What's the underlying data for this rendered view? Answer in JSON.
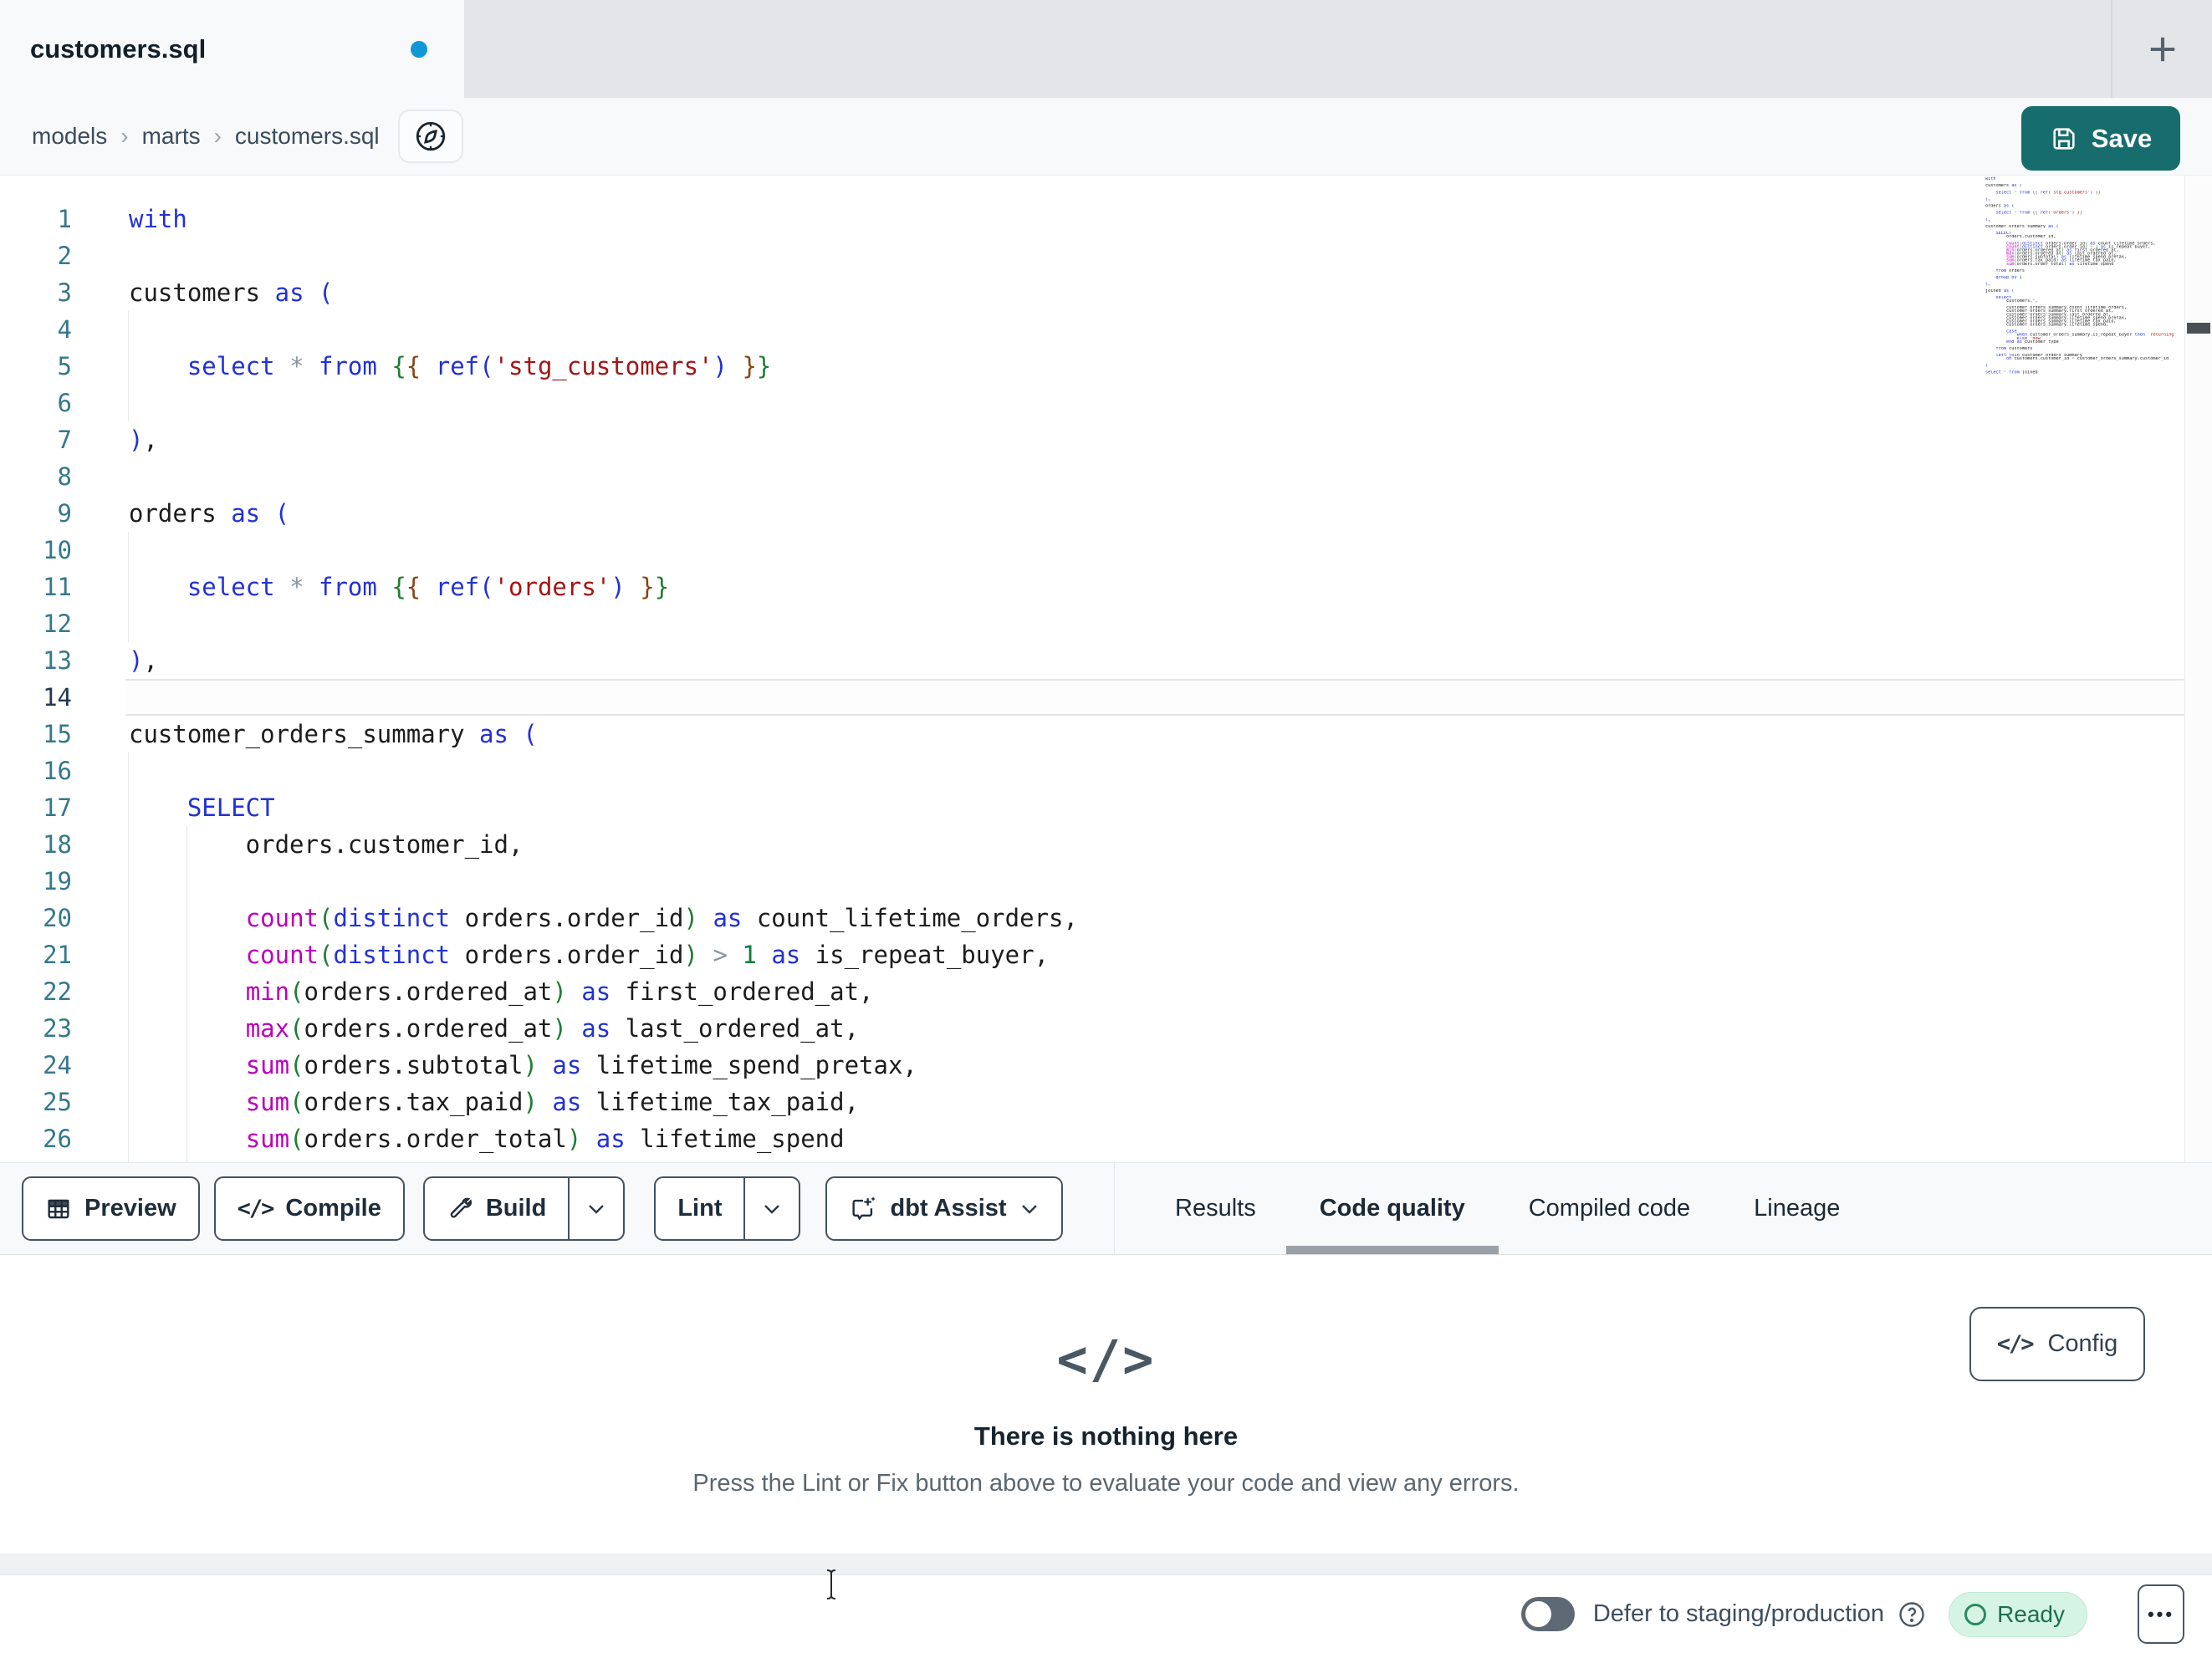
{
  "tabbar": {
    "tab_title": "customers.sql"
  },
  "breadcrumb": {
    "items": [
      "models",
      "marts",
      "customers.sql"
    ]
  },
  "save": {
    "label": "Save"
  },
  "toolbar": {
    "preview_label": "Preview",
    "compile_label": "Compile",
    "build_label": "Build",
    "lint_label": "Lint",
    "assist_label": "dbt Assist"
  },
  "panel_tabs": [
    {
      "label": "Results",
      "active": false
    },
    {
      "label": "Code quality",
      "active": true
    },
    {
      "label": "Compiled code",
      "active": false
    },
    {
      "label": "Lineage",
      "active": false
    }
  ],
  "empty_state": {
    "title": "There is nothing here",
    "subtitle": "Press the Lint or Fix button above to evaluate your code and view any errors.",
    "config_label": "Config"
  },
  "statusbar": {
    "defer_label": "Defer to staging/production",
    "ready_label": "Ready"
  },
  "colors": {
    "accent_teal": "#176d6d",
    "modified_dot_blue": "#1197d6",
    "ready_bg": "#d6f4e4",
    "ready_text": "#1d6f4e",
    "tab_bar_gray": "#e3e5e8",
    "panel_gray": "#f8f9fa",
    "syntax": {
      "keyword": "#2231d6",
      "function": "#bb00bb",
      "string": "#a31515",
      "number": "#0e7a3a",
      "bracket_blue": "#2231d6",
      "bracket_green": "#1e7e34",
      "bracket_brown": "#8b4513",
      "operator": "#8a96a3",
      "text": "#1c1c1c",
      "line_number": "#35788c",
      "active_line_number": "#203a54"
    }
  },
  "editor": {
    "visible_lines": 26,
    "active_line": 14,
    "lines": [
      [
        [
          "k",
          "with"
        ]
      ],
      [],
      [
        [
          "t",
          "customers "
        ],
        [
          "k",
          "as"
        ],
        [
          "t",
          " "
        ],
        [
          "b",
          "("
        ]
      ],
      [],
      [
        [
          "t",
          "    "
        ],
        [
          "k",
          "select"
        ],
        [
          "t",
          " "
        ],
        [
          "o",
          "*"
        ],
        [
          "t",
          " "
        ],
        [
          "k",
          "from"
        ],
        [
          "t",
          " "
        ],
        [
          "g",
          "{"
        ],
        [
          "w",
          "{"
        ],
        [
          "t",
          " "
        ],
        [
          "k",
          "ref"
        ],
        [
          "b",
          "("
        ],
        [
          "s",
          "'stg_customers'"
        ],
        [
          "b",
          ")"
        ],
        [
          "t",
          " "
        ],
        [
          "w",
          "}"
        ],
        [
          "g",
          "}"
        ]
      ],
      [],
      [
        [
          "b",
          ")"
        ],
        [
          "t",
          ","
        ]
      ],
      [],
      [
        [
          "t",
          "orders "
        ],
        [
          "k",
          "as"
        ],
        [
          "t",
          " "
        ],
        [
          "b",
          "("
        ]
      ],
      [],
      [
        [
          "t",
          "    "
        ],
        [
          "k",
          "select"
        ],
        [
          "t",
          " "
        ],
        [
          "o",
          "*"
        ],
        [
          "t",
          " "
        ],
        [
          "k",
          "from"
        ],
        [
          "t",
          " "
        ],
        [
          "g",
          "{"
        ],
        [
          "w",
          "{"
        ],
        [
          "t",
          " "
        ],
        [
          "k",
          "ref"
        ],
        [
          "b",
          "("
        ],
        [
          "s",
          "'orders'"
        ],
        [
          "b",
          ")"
        ],
        [
          "t",
          " "
        ],
        [
          "w",
          "}"
        ],
        [
          "g",
          "}"
        ]
      ],
      [],
      [
        [
          "b",
          ")"
        ],
        [
          "t",
          ","
        ]
      ],
      [],
      [
        [
          "t",
          "customer_orders_summary "
        ],
        [
          "k",
          "as"
        ],
        [
          "t",
          " "
        ],
        [
          "b",
          "("
        ]
      ],
      [],
      [
        [
          "t",
          "    "
        ],
        [
          "k",
          "SELECT"
        ]
      ],
      [
        [
          "t",
          "        orders.customer_id,"
        ]
      ],
      [],
      [
        [
          "t",
          "        "
        ],
        [
          "f",
          "count"
        ],
        [
          "g",
          "("
        ],
        [
          "k",
          "distinct"
        ],
        [
          "t",
          " orders.order_id"
        ],
        [
          "g",
          ")"
        ],
        [
          "t",
          " "
        ],
        [
          "k",
          "as"
        ],
        [
          "t",
          " count_lifetime_orders,"
        ]
      ],
      [
        [
          "t",
          "        "
        ],
        [
          "f",
          "count"
        ],
        [
          "g",
          "("
        ],
        [
          "k",
          "distinct"
        ],
        [
          "t",
          " orders.order_id"
        ],
        [
          "g",
          ")"
        ],
        [
          "t",
          " "
        ],
        [
          "o",
          ">"
        ],
        [
          "t",
          " "
        ],
        [
          "n",
          "1"
        ],
        [
          "t",
          " "
        ],
        [
          "k",
          "as"
        ],
        [
          "t",
          " is_repeat_buyer,"
        ]
      ],
      [
        [
          "t",
          "        "
        ],
        [
          "f",
          "min"
        ],
        [
          "g",
          "("
        ],
        [
          "t",
          "orders.ordered_at"
        ],
        [
          "g",
          ")"
        ],
        [
          "t",
          " "
        ],
        [
          "k",
          "as"
        ],
        [
          "t",
          " first_ordered_at,"
        ]
      ],
      [
        [
          "t",
          "        "
        ],
        [
          "f",
          "max"
        ],
        [
          "g",
          "("
        ],
        [
          "t",
          "orders.ordered_at"
        ],
        [
          "g",
          ")"
        ],
        [
          "t",
          " "
        ],
        [
          "k",
          "as"
        ],
        [
          "t",
          " last_ordered_at,"
        ]
      ],
      [
        [
          "t",
          "        "
        ],
        [
          "f",
          "sum"
        ],
        [
          "g",
          "("
        ],
        [
          "t",
          "orders.subtotal"
        ],
        [
          "g",
          ")"
        ],
        [
          "t",
          " "
        ],
        [
          "k",
          "as"
        ],
        [
          "t",
          " lifetime_spend_pretax,"
        ]
      ],
      [
        [
          "t",
          "        "
        ],
        [
          "f",
          "sum"
        ],
        [
          "g",
          "("
        ],
        [
          "t",
          "orders.tax_paid"
        ],
        [
          "g",
          ")"
        ],
        [
          "t",
          " "
        ],
        [
          "k",
          "as"
        ],
        [
          "t",
          " lifetime_tax_paid,"
        ]
      ],
      [
        [
          "t",
          "        "
        ],
        [
          "f",
          "sum"
        ],
        [
          "g",
          "("
        ],
        [
          "t",
          "orders.order_total"
        ],
        [
          "g",
          ")"
        ],
        [
          "t",
          " "
        ],
        [
          "k",
          "as"
        ],
        [
          "t",
          " lifetime_spend"
        ]
      ],
      [],
      [
        [
          "t",
          "    "
        ],
        [
          "k",
          "from"
        ],
        [
          "t",
          " orders"
        ]
      ],
      [],
      [
        [
          "t",
          "    "
        ],
        [
          "k",
          "group by"
        ],
        [
          "t",
          " "
        ],
        [
          "n",
          "1"
        ]
      ],
      [],
      [
        [
          "b",
          ")"
        ],
        [
          "t",
          ","
        ]
      ],
      [],
      [
        [
          "t",
          "joined "
        ],
        [
          "k",
          "as"
        ],
        [
          "t",
          " "
        ],
        [
          "b",
          "("
        ]
      ],
      [],
      [
        [
          "t",
          "    "
        ],
        [
          "k",
          "select"
        ]
      ],
      [
        [
          "t",
          "        customers."
        ],
        [
          "o",
          "*"
        ],
        [
          "t",
          ","
        ]
      ],
      [],
      [
        [
          "t",
          "        customer_orders_summary.count_lifetime_orders,"
        ]
      ],
      [
        [
          "t",
          "        customer_orders_summary.first_ordered_at,"
        ]
      ],
      [
        [
          "t",
          "        customer_orders_summary.last_ordered_at,"
        ]
      ],
      [
        [
          "t",
          "        customer_orders_summary.lifetime_spend_pretax,"
        ]
      ],
      [
        [
          "t",
          "        customer_orders_summary.lifetime_tax_paid,"
        ]
      ],
      [
        [
          "t",
          "        customer_orders_summary.lifetime_spend,"
        ]
      ],
      [],
      [
        [
          "t",
          "        "
        ],
        [
          "k",
          "case"
        ]
      ],
      [
        [
          "t",
          "            "
        ],
        [
          "k",
          "when"
        ],
        [
          "t",
          " customer_orders_summary.is_repeat_buyer "
        ],
        [
          "k",
          "then"
        ],
        [
          "t",
          " "
        ],
        [
          "s",
          "'returning'"
        ]
      ],
      [
        [
          "t",
          "            "
        ],
        [
          "k",
          "else"
        ],
        [
          "t",
          " "
        ],
        [
          "s",
          "'new'"
        ]
      ],
      [
        [
          "t",
          "        "
        ],
        [
          "k",
          "end"
        ],
        [
          "t",
          " "
        ],
        [
          "k",
          "as"
        ],
        [
          "t",
          " customer_type"
        ]
      ],
      [],
      [
        [
          "t",
          "    "
        ],
        [
          "k",
          "from"
        ],
        [
          "t",
          " customers"
        ]
      ],
      [],
      [
        [
          "t",
          "    "
        ],
        [
          "k",
          "left join"
        ],
        [
          "t",
          " customer_orders_summary"
        ]
      ],
      [
        [
          "t",
          "        "
        ],
        [
          "k",
          "on"
        ],
        [
          "t",
          " customers.customer_id "
        ],
        [
          "o",
          "="
        ],
        [
          "t",
          " customer_orders_summary.customer_id"
        ]
      ],
      [],
      [
        [
          "b",
          ")"
        ]
      ],
      [],
      [
        [
          "k",
          "select"
        ],
        [
          "t",
          " "
        ],
        [
          "o",
          "*"
        ],
        [
          "t",
          " "
        ],
        [
          "k",
          "from"
        ],
        [
          "t",
          " joined"
        ]
      ]
    ]
  }
}
